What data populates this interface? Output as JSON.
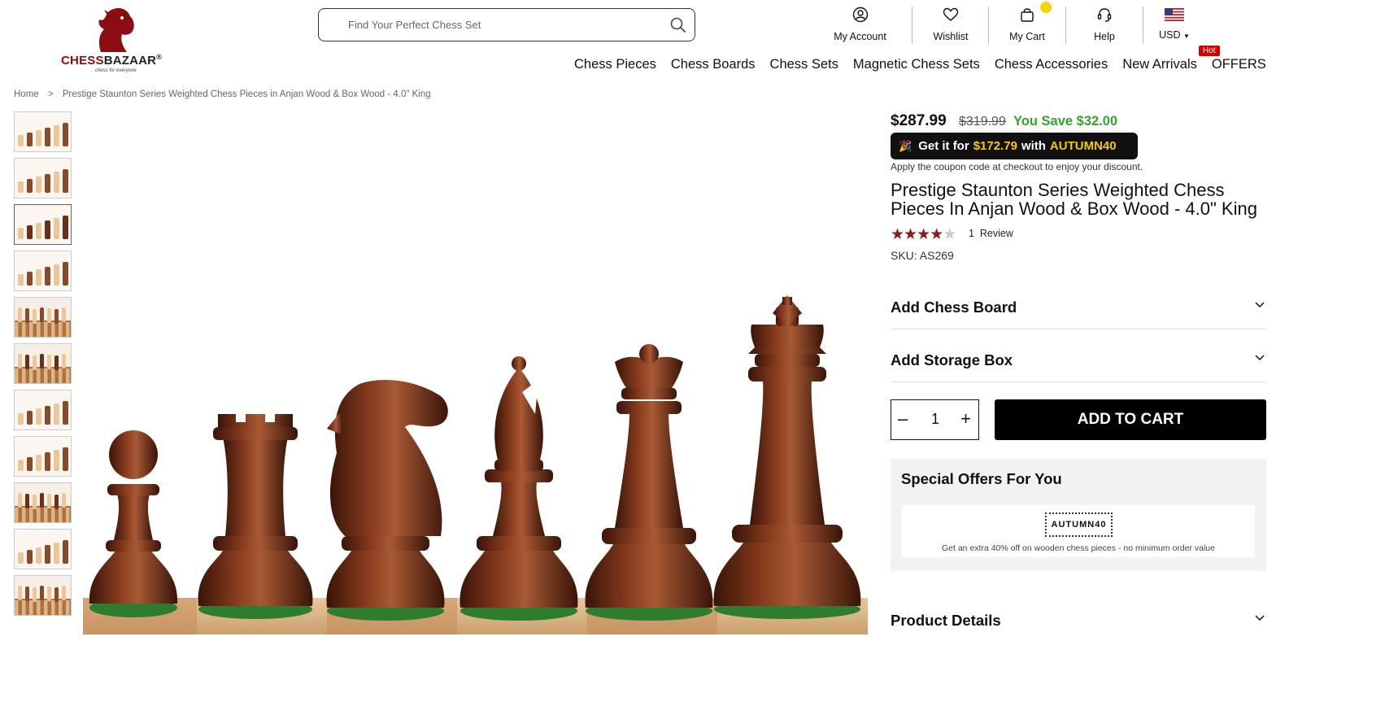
{
  "header": {
    "brand_primary": "CHESS",
    "brand_secondary": "BAZAAR",
    "brand_reg": "®",
    "tagline": "chess for everyone",
    "search_placeholder": "Find Your Perfect Chess Set",
    "util": {
      "account": "My Account",
      "wishlist": "Wishlist",
      "cart": "My Cart",
      "help": "Help",
      "currency": "USD"
    },
    "nav": [
      "Chess Pieces",
      "Chess Boards",
      "Chess Sets",
      "Magnetic Chess Sets",
      "Chess Accessories",
      "New Arrivals",
      "OFFERS"
    ],
    "hot_badge": "Hot"
  },
  "breadcrumb": {
    "home": "Home",
    "separator": ">",
    "current": "Prestige Staunton Series Weighted Chess Pieces in Anjan Wood & Box Wood - 4.0\" King"
  },
  "product": {
    "price": "$287.99",
    "old_price": "$319.99",
    "save_text": "You Save $32.00",
    "coupon_banner": {
      "prefix": "Get it for",
      "amount": "$172.79",
      "mid": "with",
      "code": "AUTUMN40"
    },
    "coupon_note": "Apply the coupon code at checkout to enjoy your discount.",
    "title": "Prestige Staunton Series Weighted Chess Pieces In Anjan Wood & Box Wood - 4.0\" King",
    "rating": 4,
    "rating_max": 5,
    "review_count": "1",
    "review_label": "Review",
    "sku": "SKU: AS269",
    "accordions": {
      "chess_board": "Add Chess Board",
      "storage_box": "Add Storage Box",
      "details": "Product Details"
    },
    "quantity": "1",
    "qty_minus": "–",
    "qty_plus": "+",
    "add_to_cart": "ADD TO CART",
    "offers": {
      "heading": "Special Offers For You",
      "code": "AUTUMN40",
      "description": "Get an extra 40% off on wooden chess pieces - no minimum order value"
    }
  },
  "colors": {
    "brand_red": "#8b0d12",
    "save_green": "#2fa52a",
    "coupon_yellow": "#f7c900",
    "star_red": "#8b1a1a",
    "wood_dark": "#5a2614",
    "wood_light": "#e8c89a"
  }
}
